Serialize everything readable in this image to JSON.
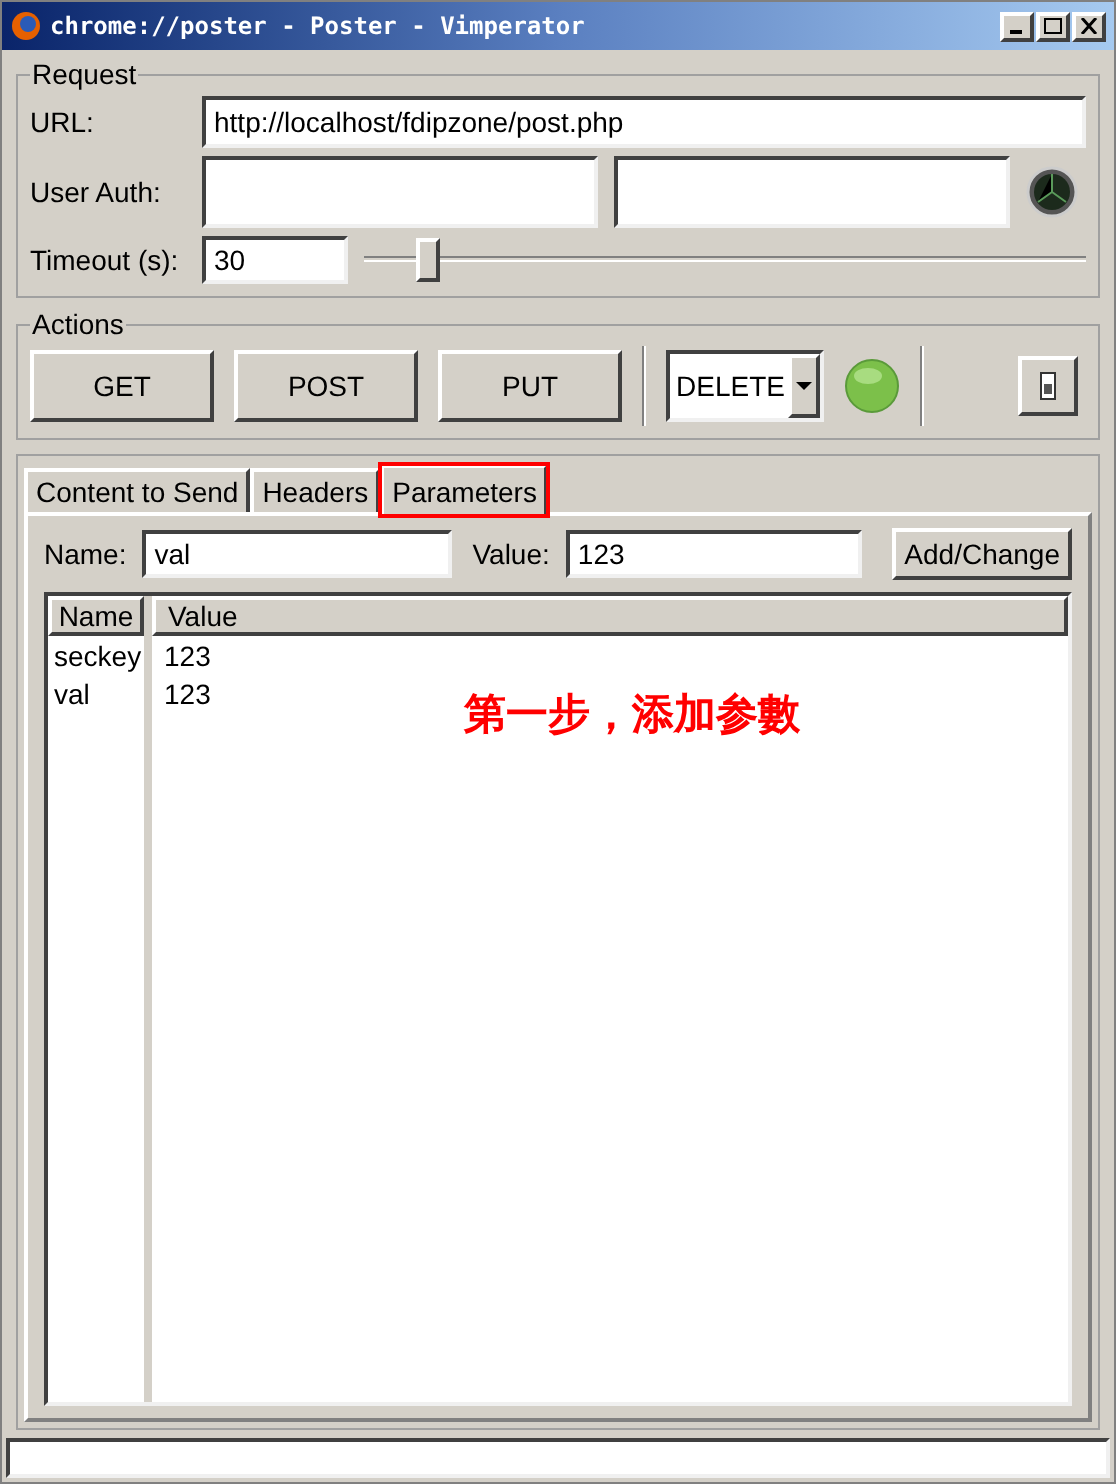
{
  "window": {
    "title": "chrome://poster - Poster - Vimperator"
  },
  "request": {
    "legend": "Request",
    "url_label": "URL:",
    "url": "http://localhost/fdipzone/post.php",
    "auth_label": "User Auth:",
    "timeout_label": "Timeout (s):",
    "timeout": "30",
    "timeout_slider": {
      "level": 0.09
    }
  },
  "actions": {
    "legend": "Actions",
    "buttons": [
      "GET",
      "POST",
      "PUT"
    ],
    "method_select": "DELETE"
  },
  "tabs": [
    {
      "label": "Content to Send",
      "selected": false,
      "highlighted": false
    },
    {
      "label": "Headers",
      "selected": false,
      "highlighted": false
    },
    {
      "label": "Parameters",
      "selected": true,
      "highlighted": true
    }
  ],
  "parameters": {
    "name_label": "Name:",
    "name": "val",
    "value_label": "Value:",
    "value": "123",
    "add_button": "Add/Change",
    "columns": [
      "Name",
      "Value"
    ],
    "rows": [
      {
        "name": "seckey",
        "value": "123"
      },
      {
        "name": "val",
        "value": "123"
      }
    ],
    "annotation": "第一步，添加参數"
  }
}
